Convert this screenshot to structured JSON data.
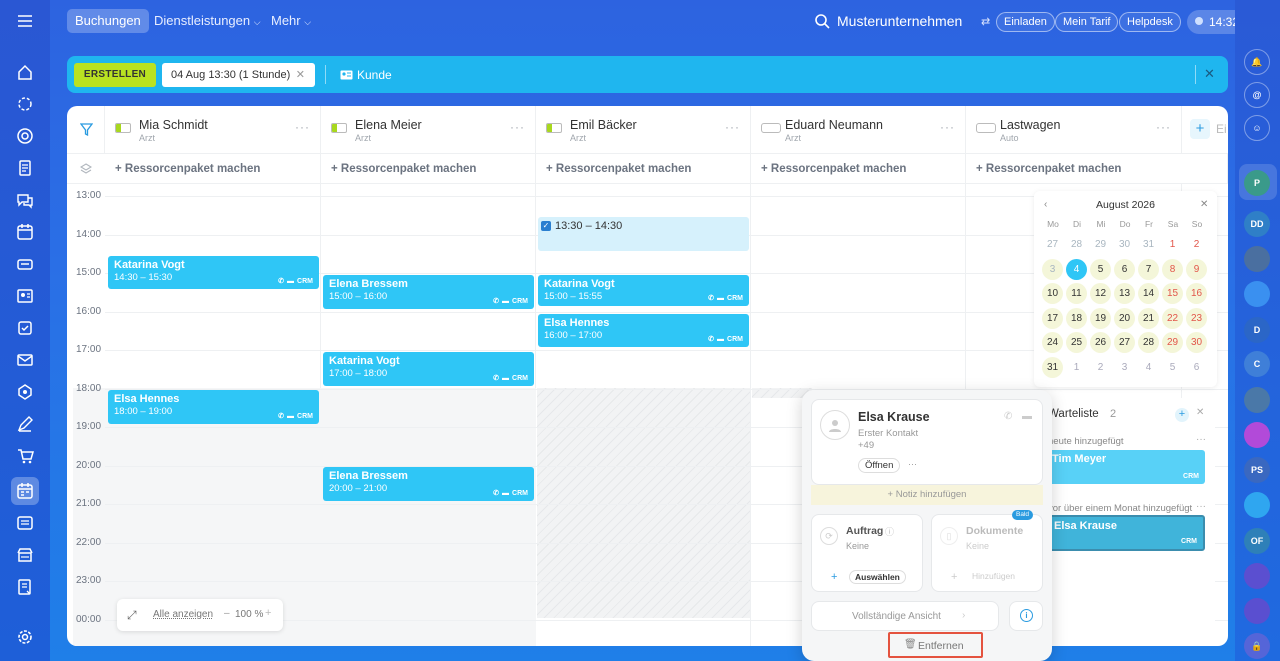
{
  "topbar": {
    "tabs": [
      "Buchungen",
      "Dienstleistungen",
      "Mehr"
    ],
    "company": "Musterunternehmen",
    "links": [
      "Einladen",
      "Mein Tarif",
      "Helpdesk"
    ],
    "time": "14:32"
  },
  "toolbar": {
    "create_label": "ERSTELLEN",
    "date_chip": "04 Aug 13:30 (1 Stunde)",
    "client_label": "Kunde"
  },
  "resources": [
    {
      "name": "Mia Schmidt",
      "role": "Arzt"
    },
    {
      "name": "Elena Meier",
      "role": "Arzt"
    },
    {
      "name": "Emil Bäcker",
      "role": "Arzt"
    },
    {
      "name": "Eduard Neumann",
      "role": "Arzt"
    },
    {
      "name": "Lastwagen",
      "role": "Auto"
    }
  ],
  "extra_column_label": "Ei",
  "package_label": "+ Ressorcenpaket machen",
  "hours": [
    "13:00",
    "14:00",
    "15:00",
    "16:00",
    "17:00",
    "18:00",
    "19:00",
    "20:00",
    "21:00",
    "22:00",
    "23:00",
    "00:00"
  ],
  "events": [
    {
      "column": 0,
      "name": "Katarina Vogt",
      "time": "14:30 – 15:30"
    },
    {
      "column": 0,
      "name": "Elsa Hennes",
      "time": "18:00 – 19:00"
    },
    {
      "column": 1,
      "name": "Elena Bressem",
      "time": "15:00 – 16:00"
    },
    {
      "column": 1,
      "name": "Katarina Vogt",
      "time": "17:00 – 18:00"
    },
    {
      "column": 1,
      "name": "Elena Bressem",
      "time": "20:00 – 21:00"
    },
    {
      "column": 2,
      "name": "Katarina Vogt",
      "time": "15:00 – 15:55"
    },
    {
      "column": 2,
      "name": "Elsa Hennes",
      "time": "16:00 – 17:00"
    }
  ],
  "selection": {
    "column": 2,
    "time": "13:30 – 14:30"
  },
  "crm_tag": "CRM",
  "zoom": {
    "show_all": "Alle anzeigen",
    "value": "100 %",
    "minus": "–",
    "plus": "+"
  },
  "calendar": {
    "month": "August 2026",
    "weekdays": [
      "Mo",
      "Di",
      "Mi",
      "Do",
      "Fr",
      "Sa",
      "So"
    ],
    "weeks": [
      [
        "27",
        "28",
        "29",
        "30",
        "31",
        "1",
        "2"
      ],
      [
        "3",
        "4",
        "5",
        "6",
        "7",
        "8",
        "9"
      ],
      [
        "10",
        "11",
        "12",
        "13",
        "14",
        "15",
        "16"
      ],
      [
        "17",
        "18",
        "19",
        "20",
        "21",
        "22",
        "23"
      ],
      [
        "24",
        "25",
        "26",
        "27",
        "28",
        "29",
        "30"
      ],
      [
        "31",
        "1",
        "2",
        "3",
        "4",
        "5",
        "6"
      ]
    ],
    "selected": "4"
  },
  "waitlist": {
    "title": "Warteliste",
    "count": "2",
    "group1": "heute hinzugefügt",
    "item1": "Tim Meyer",
    "group2": "vor über einem Monat hinzugefügt",
    "item2": "Elsa Krause"
  },
  "popup": {
    "client_name": "Elsa Krause",
    "client_type": "Erster Kontakt",
    "phone": "+49",
    "open_label": "Öffnen",
    "note_label": "+ Notiz hinzufügen",
    "order_label": "Auftrag",
    "order_value": "Keine",
    "order_button": "Auswählen",
    "docs_label": "Dokumente",
    "docs_value": "Keine",
    "docs_badge": "Bald",
    "docs_button": "Hinzufügen",
    "full_view": "Vollständige Ansicht",
    "remove_label": "Entfernen"
  },
  "right_nav": {
    "avatars": [
      "P",
      "DD",
      "D",
      "C",
      "PS",
      "OF"
    ]
  },
  "colors": {
    "accent": "#2fc6f6",
    "create": "#b9e221",
    "highlight": "#e2564a"
  }
}
